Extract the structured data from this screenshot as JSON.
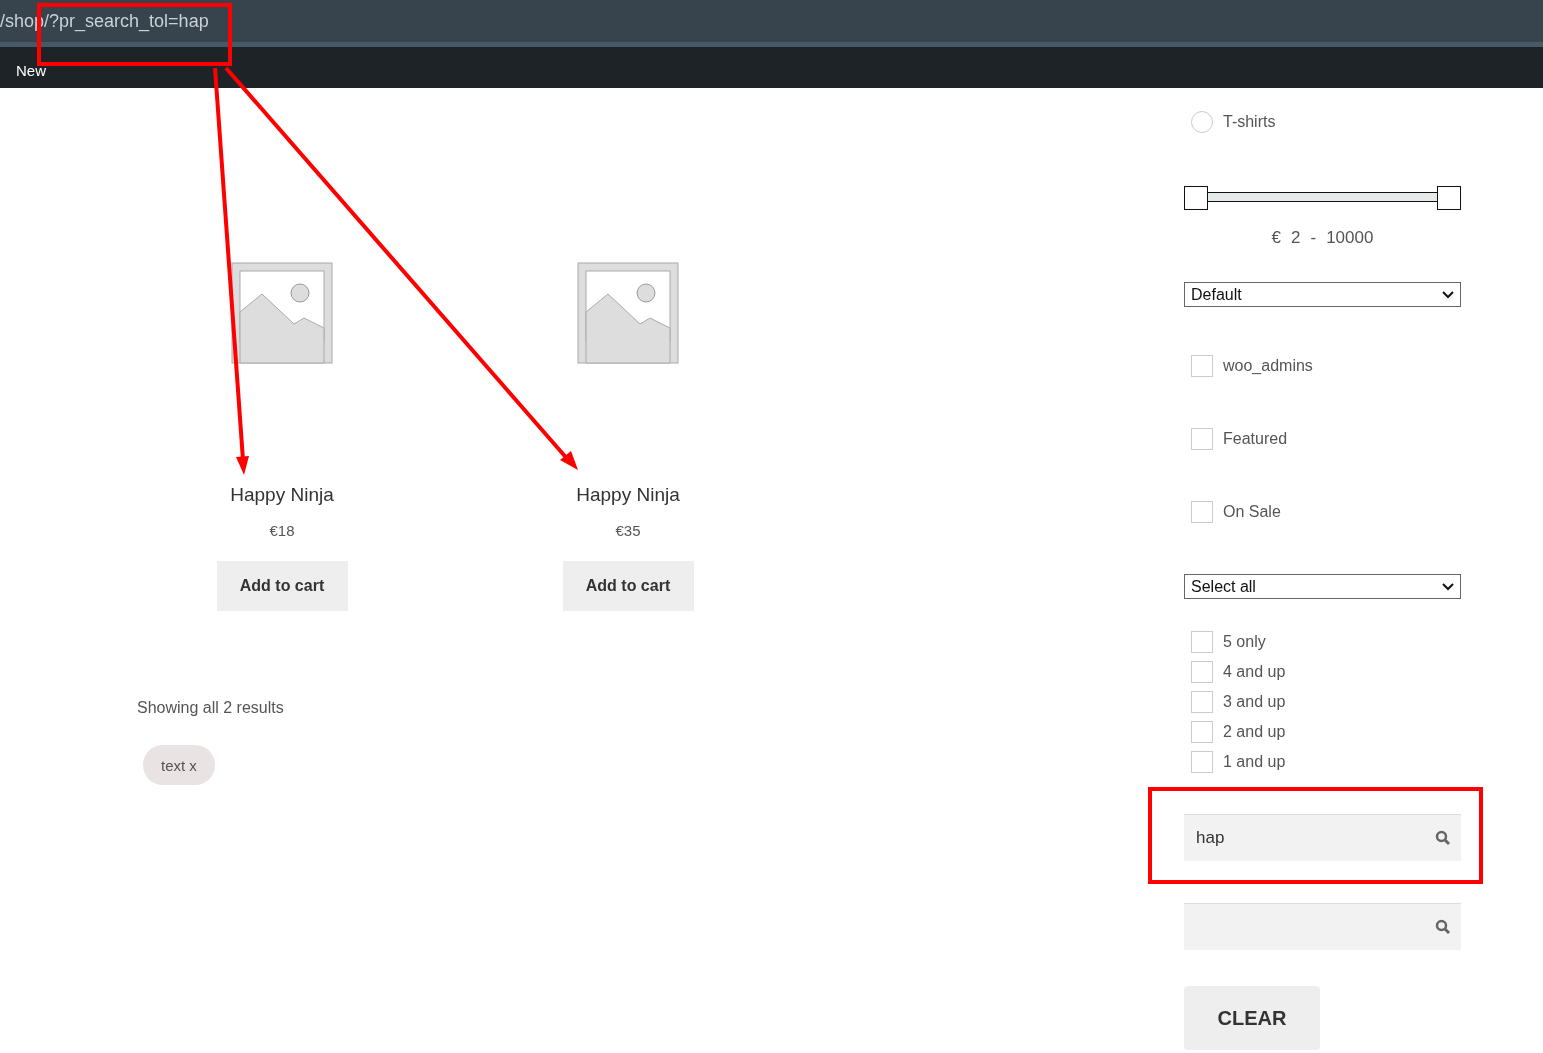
{
  "address_bar": {
    "url": "/shop/?pr_search_tol=hap",
    "highlighted": true
  },
  "admin_bar": {
    "items": [
      {
        "label": "New"
      }
    ]
  },
  "products": [
    {
      "name": "Happy Ninja",
      "price": "€18",
      "button": "Add to cart"
    },
    {
      "name": "Happy Ninja",
      "price": "€35",
      "button": "Add to cart"
    }
  ],
  "result_count": "Showing all 2 results",
  "active_filters": [
    {
      "label": "text x"
    }
  ],
  "sidebar": {
    "categories": [
      {
        "label": "T-shirts",
        "selected": false
      }
    ],
    "price_range": {
      "thumbs": [
        {
          "level": 0
        },
        {
          "level": 1
        }
      ],
      "currency": "€",
      "min": "2",
      "separator": "-",
      "max": "10000"
    },
    "order_select": {
      "value": "Default"
    },
    "options": [
      {
        "label": "woo_admins",
        "checked": false
      },
      {
        "label": "Featured",
        "checked": false
      },
      {
        "label": "On Sale",
        "checked": false
      }
    ],
    "rating_select": {
      "value": "Select all"
    },
    "ratings": [
      {
        "label": "5 only",
        "checked": false
      },
      {
        "label": "4 and up",
        "checked": false
      },
      {
        "label": "3 and up",
        "checked": false
      },
      {
        "label": "2 and up",
        "checked": false
      },
      {
        "label": "1 and up",
        "checked": false
      }
    ],
    "search_fields": [
      {
        "value": "hap",
        "highlighted": true
      },
      {
        "highlighted": false
      }
    ],
    "clear_button": "CLEAR"
  },
  "annotations": [
    {
      "kind": "arrow"
    },
    {
      "kind": "arrow"
    }
  ]
}
